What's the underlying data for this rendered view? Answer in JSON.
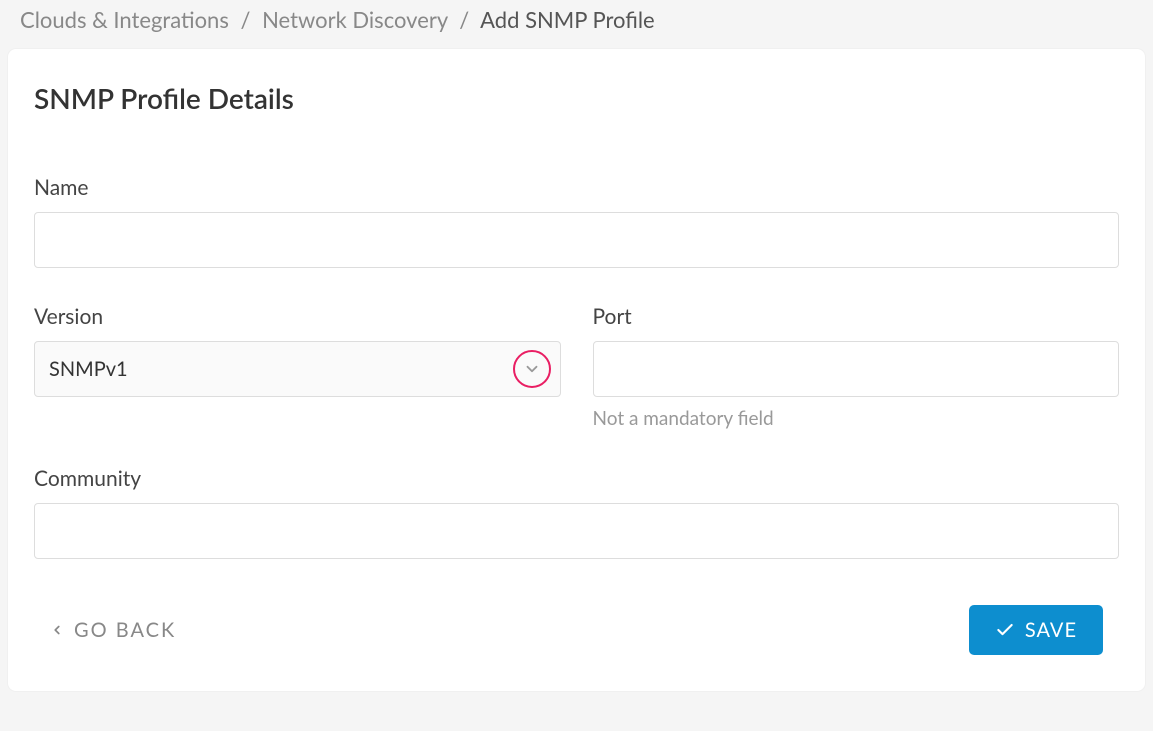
{
  "breadcrumb": {
    "items": [
      {
        "label": "Clouds & Integrations"
      },
      {
        "label": "Network Discovery"
      }
    ],
    "current": "Add SNMP Profile"
  },
  "page": {
    "title": "SNMP Profile Details"
  },
  "form": {
    "name": {
      "label": "Name",
      "value": ""
    },
    "version": {
      "label": "Version",
      "selected": "SNMPv1"
    },
    "port": {
      "label": "Port",
      "value": "",
      "helper": "Not a mandatory field"
    },
    "community": {
      "label": "Community",
      "value": ""
    }
  },
  "actions": {
    "back": "GO BACK",
    "save": "SAVE"
  }
}
